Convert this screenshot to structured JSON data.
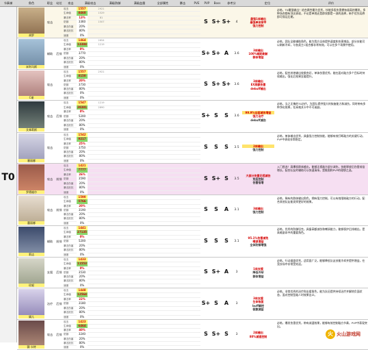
{
  "header": {
    "cols": [
      "节奏梯",
      "角色",
      "职业",
      "站位",
      "攻击",
      "满级攻击",
      "满级防御",
      "满级血量",
      "全部属性",
      "暴击",
      "PVE",
      "PVP",
      "Boss",
      "参考分",
      "定位",
      "评价"
    ]
  },
  "tier_label": "T0",
  "stat_labels": [
    "攻击",
    "生命值",
    "暴击率",
    "防御",
    "暴击伤害",
    "暴击抵抗",
    "速度"
  ],
  "characters": [
    {
      "name": "胡罗",
      "class": "攻击",
      "position": "",
      "stats": [
        "1557",
        "8460",
        "13%",
        "3360",
        "20%",
        "80%",
        "0%"
      ],
      "extra": [
        "2921",
        "1529",
        "81",
        "1507",
        "",
        "",
        ""
      ],
      "pve": "S",
      "pvp": "S+",
      "boss": "S+",
      "score": "4",
      "tags": [
        "最强1体输出",
        "最强单体穿甲",
        "强力控制"
      ],
      "tag_colors": [
        "#d40000",
        "#d40000",
        "#d40000"
      ],
      "desc": "必练，T0最强输出！综合属性最为优秀，技能多段伤害拥有极高的爆发，多种场合都有顶尖表现，不论是单挑还是群攻都是一流的选择，新手优先培养即可保证后期。"
    },
    {
      "name": "米利马斯",
      "class": "辅助",
      "position": "后排",
      "stats": [
        "1464",
        "13384",
        "0%",
        "3770",
        "20%",
        "80%",
        "0%"
      ],
      "extra": [
        "2654",
        "1219",
        "",
        "",
        "",
        "",
        ""
      ],
      "pve": "S+",
      "pvp": "S+",
      "boss": "A",
      "score": "3.6",
      "tags": [
        "3体输出",
        "100%辅助刷新",
        "群体增益"
      ],
      "tag_colors": [
        "#d40000",
        "#d40000",
        "#d40000"
      ],
      "desc": "必练，团队全能辅助角色，能为我方全体提供速度和伤害增益，部分技能可以刷新冷却，与各类主C组合都非常有效，可以在多个场景中使用。"
    },
    {
      "name": "C佬",
      "class": "攻击",
      "position": "",
      "stats": [
        "1557",
        "8150",
        "20%",
        "3730",
        "80%",
        "0%",
        "0%"
      ],
      "extra": [
        "2921",
        "",
        "",
        "",
        "",
        "",
        ""
      ],
      "pve": "S",
      "pvp": "S+",
      "boss": "S+",
      "score": "3.6",
      "tags": [
        "3体输出",
        "EX高额伤害",
        "debuff输出"
      ],
      "tag_colors": [
        "#d40000",
        "#d40000",
        "#d40000"
      ],
      "desc": "必练，配合其他输出效果良好，单体伤害优秀，能在面对敌方多个目标时持续输出，强化后效果显著提升。"
    },
    {
      "name": "艾弗莉斯",
      "class": "攻击",
      "position": "后排",
      "stats": [
        "1547",
        "28381",
        "0%",
        "5200",
        "20%",
        "80%",
        "0%"
      ],
      "extra": [
        "1219",
        "2890",
        "",
        "",
        "",
        "",
        ""
      ],
      "pve": "S+",
      "pvp": "S",
      "boss": "S",
      "score": "3.6",
      "tags": [
        "99.9%全面减伤增益",
        "强力治疗",
        "debuff减伤"
      ],
      "tag_colors": [
        "#d40000",
        "#d40000",
        "#333333"
      ],
      "desc": "必练，当之无愧的T0治疗，为团队提供强大的恢复能力和减伤，同时带有多种净化效果，在高难关卡中不可或缺。"
    },
    {
      "name": "塞丽娜",
      "class": "攻击",
      "position": "",
      "stats": [
        "1542",
        "9217",
        "25%",
        "3750",
        "20%",
        "80%",
        "0%"
      ],
      "extra": [
        "",
        "",
        "",
        "",
        "",
        "",
        ""
      ],
      "pve": "S",
      "pvp": "S",
      "boss": "S",
      "score": "3.5",
      "tags": [
        "2体输出",
        "强力控制"
      ],
      "tag_colors": [
        "#d40000",
        "#333333"
      ],
      "desc": "必练，单体输出优秀，具备强力控制技能，能够有效打断敌方的关键行动，PVP中表现非常稳定。"
    },
    {
      "name": "罗德维尔",
      "class": "攻击",
      "position": "前排",
      "stats": [
        "1421",
        "7777",
        "26%",
        "3590",
        "20%",
        "80%",
        "0%"
      ],
      "extra": [
        "",
        "",
        "",
        "",
        "",
        "",
        ""
      ],
      "pve": "S",
      "pvp": "S+",
      "boss": "S",
      "score": "3.5",
      "tags": [
        "大部分伤害无视减伤",
        "免疫控制",
        "伤害倍增"
      ],
      "tag_colors": [
        "#d40000",
        "#333333",
        "#333333"
      ],
      "desc": "入门首选！高爆发群体输出，能够无视敌方部分减伤，技能释放后伤害成倍增长，配合队友的辅助可以快速清场，是推图和PVP的理想之选。"
    },
    {
      "name": "蕾丽娜",
      "class": "攻击",
      "position": "前排",
      "stats": [
        "1590",
        "5766",
        "20%",
        "3190",
        "20%",
        "80%",
        "0%"
      ],
      "extra": [
        "",
        "",
        "",
        "",
        "",
        "",
        ""
      ],
      "pve": "S",
      "pvp": "S",
      "boss": "A",
      "score": "3.1",
      "tags": [
        "3体输出",
        "强力控制"
      ],
      "tag_colors": [
        "#d40000",
        "#333333"
      ],
      "desc": "必练，稀有的群体输出角色，拥有强力控制，可以有效限制敌方的行动，配合其他队友能发挥更好的效果。"
    },
    {
      "name": "莉洁",
      "class": "辅助",
      "position": "前排",
      "stats": [
        "1441",
        "27135",
        "0%",
        "5200",
        "20%",
        "80%",
        "0%"
      ],
      "extra": [
        "",
        "",
        "",
        "",
        "",
        "",
        ""
      ],
      "pve": "S",
      "pvp": "S",
      "boss": "S",
      "score": "3.1",
      "tags": [
        "95.1%伤害减免",
        "嘲讽增益",
        "全体防御增强"
      ],
      "tag_colors": [
        "#d40000",
        "#d40000",
        "#333333"
      ],
      "desc": "必练，优秀的防御坦克，具备高额减伤和嘲讽能力，能够保护后排输出，是高难副本中的重要角色。"
    },
    {
      "name": "珍妮",
      "class": "支援",
      "position": "后排",
      "stats": [
        "1433",
        "11553",
        "0%",
        "3530",
        "20%",
        "80%",
        "0%"
      ],
      "extra": [
        "",
        "",
        "",
        "",
        "",
        "",
        ""
      ],
      "pve": "S",
      "pvp": "S+",
      "boss": "A",
      "score": "3",
      "tags": [
        "1体支援",
        "降低冷却",
        "群体增益"
      ],
      "tag_colors": [
        "#d40000",
        "#333333",
        "#333333"
      ],
      "desc": "必练，行动速度优秀，适用面广泛，能够降低队友技能冷却并提供增益，在竞技场中非常受欢迎。"
    },
    {
      "name": "黛儿",
      "class": "治疗",
      "position": "后排",
      "stats": [
        "1448",
        "12564",
        "22%",
        "3180",
        "20%",
        "80%",
        "0%"
      ],
      "extra": [
        "",
        "",
        "",
        "",
        "",
        "",
        ""
      ],
      "pve": "S+",
      "pvp": "S",
      "boss": "A",
      "score": "3",
      "tags": [
        "3体支援",
        "生命恢复",
        "buff解控",
        "驱散减益"
      ],
      "tag_colors": [
        "#d40000",
        "#d40000",
        "#333333",
        "#333333"
      ],
      "desc": "必练，非常优秀的治疗和支援角色，能为队伍提供持续治疗并解除负面状态，面对控制型敌人时效果出众。"
    },
    {
      "name": "薇·卡特",
      "class": "攻击",
      "position": "后排",
      "stats": [
        "1423",
        "6464",
        "40%",
        "3240",
        "20%",
        "80%",
        "0%"
      ],
      "extra": [
        "",
        "",
        "",
        "",
        "",
        "",
        ""
      ],
      "pve": "S",
      "pvp": "S+",
      "boss": "S",
      "score": "3",
      "tags": [
        "2体输出",
        "80%减速控制"
      ],
      "tag_colors": [
        "#d40000",
        "#d40000"
      ],
      "desc": "必练，爆发伤害优秀，带有减速效果，能够有效控制敌方节奏，PVP中表现突出。"
    }
  ],
  "watermark": {
    "logo": "火",
    "text": "火山游戏网"
  }
}
